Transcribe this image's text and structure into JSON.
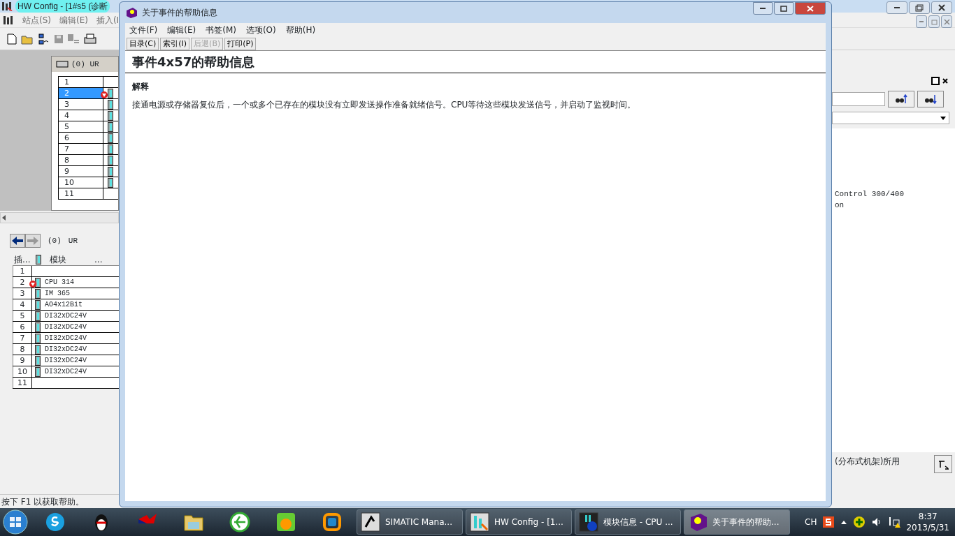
{
  "main_window": {
    "title": "HW Config - [1#s5 (诊断",
    "menu": [
      "站点(S)",
      "编辑(E)",
      "插入(I"
    ],
    "rack": {
      "title": "(0)   UR",
      "rows": [
        {
          "slot": "1",
          "selected": false,
          "fault": false,
          "module": false
        },
        {
          "slot": "2",
          "selected": true,
          "fault": true,
          "module": true
        },
        {
          "slot": "3",
          "selected": false,
          "fault": false,
          "module": true
        },
        {
          "slot": "4",
          "selected": false,
          "fault": false,
          "module": true
        },
        {
          "slot": "5",
          "selected": false,
          "fault": false,
          "module": true
        },
        {
          "slot": "6",
          "selected": false,
          "fault": false,
          "module": true
        },
        {
          "slot": "7",
          "selected": false,
          "fault": false,
          "module": true
        },
        {
          "slot": "8",
          "selected": false,
          "fault": false,
          "module": true
        },
        {
          "slot": "9",
          "selected": false,
          "fault": false,
          "module": true
        },
        {
          "slot": "10",
          "selected": false,
          "fault": false,
          "module": true
        },
        {
          "slot": "11",
          "selected": false,
          "fault": false,
          "module": false
        }
      ]
    },
    "module_panel": {
      "path": [
        "(0)",
        "UR"
      ],
      "columns": [
        "插...",
        "模块",
        "..."
      ],
      "rows": [
        {
          "slot": "1",
          "fault": false
        },
        {
          "slot": "2",
          "module": "CPU 314",
          "fault": true
        },
        {
          "slot": "3",
          "module": "IM 365",
          "fault": false
        },
        {
          "slot": "4",
          "module": "AO4x12Bit",
          "fault": false
        },
        {
          "slot": "5",
          "module": "DI32xDC24V",
          "fault": false
        },
        {
          "slot": "6",
          "module": "DI32xDC24V",
          "fault": false
        },
        {
          "slot": "7",
          "module": "DI32xDC24V",
          "fault": false
        },
        {
          "slot": "8",
          "module": "DI32xDC24V",
          "fault": false
        },
        {
          "slot": "9",
          "module": "DI32xDC24V",
          "fault": false
        },
        {
          "slot": "10",
          "module": "DI32xDC24V",
          "fault": false
        },
        {
          "slot": "11",
          "fault": false
        }
      ]
    },
    "catalog": {
      "lines": [
        "Control 300/400",
        "on"
      ],
      "info": "(分布式机架)所用"
    },
    "status_bar": "按下 F1 以获取帮助。"
  },
  "help_window": {
    "title": "关于事件的帮助信息",
    "menu": [
      "文件(F)",
      "编辑(E)",
      "书签(M)",
      "选项(O)",
      "帮助(H)"
    ],
    "buttons": [
      {
        "label": "目录(C)",
        "disabled": false
      },
      {
        "label": "索引(I)",
        "disabled": false
      },
      {
        "label": "后退(B)",
        "disabled": true
      },
      {
        "label": "打印(P)",
        "disabled": false
      }
    ],
    "heading": "事件4x57的帮助信息",
    "section": "解释",
    "body": "接通电源或存储器复位后，一个或多个已存在的模块没有立即发送操作准备就绪信号。CPU等待这些模块发送信号，并启动了监视时间。"
  },
  "taskbar": {
    "tasks": [
      {
        "label": "SIMATIC Mana...",
        "selected": false
      },
      {
        "label": "HW Config - [1...",
        "selected": false
      },
      {
        "label": "模块信息 - CPU ...",
        "selected": false
      },
      {
        "label": "关于事件的帮助...",
        "selected": true
      }
    ],
    "input_language": "CH",
    "time": "8:37",
    "date": "2013/5/31"
  }
}
